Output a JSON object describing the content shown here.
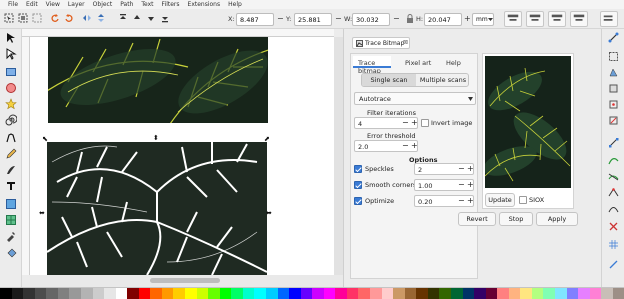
{
  "menubar": {
    "items": [
      "File",
      "Edit",
      "View",
      "Layer",
      "Object",
      "Path",
      "Text",
      "Filters",
      "Extensions",
      "Help"
    ]
  },
  "toolbar": {
    "x_label": "X:",
    "x_value": "8.487",
    "y_label": "Y:",
    "y_value": "25.881",
    "w_label": "W:",
    "w_value": "30.032",
    "h_label": "H:",
    "h_value": "20.047",
    "unit": "mm",
    "minus": "−",
    "plus": "+"
  },
  "dock": {
    "panel_tab": "Trace Bitmap",
    "close": "⊠",
    "tabs": [
      "Trace bitmap",
      "Pixel art",
      "Help"
    ],
    "scan_modes": [
      "Single scan",
      "Multiple scans"
    ],
    "algorithm": "Autotrace",
    "filter_iterations_label": "Filter iterations",
    "filter_iterations_value": "4",
    "invert_label": "Invert image",
    "error_threshold_label": "Error threshold",
    "error_threshold_value": "2.0",
    "options_heading": "Options",
    "options": [
      {
        "label": "Speckles",
        "value": "2"
      },
      {
        "label": "Smooth corners",
        "value": "1.00"
      },
      {
        "label": "Optimize",
        "value": "0.20"
      }
    ],
    "update_button": "Update",
    "sioх_label": "SIOX",
    "revert_button": "Revert",
    "stop_button": "Stop",
    "apply_button": "Apply",
    "minus": "−",
    "plus": "+"
  },
  "colors": {
    "accent": "#3a7bd5",
    "leaf_dark": "#1c2a1e",
    "leaf_yellow": "#c8d23a"
  },
  "palette": [
    "#000000",
    "#1a1a1a",
    "#333333",
    "#4d4d4d",
    "#666666",
    "#808080",
    "#999999",
    "#b3b3b3",
    "#cccccc",
    "#e6e6e6",
    "#ffffff",
    "#800000",
    "#ff0000",
    "#ff6600",
    "#ff9900",
    "#ffcc00",
    "#ffff00",
    "#ccff00",
    "#66ff00",
    "#00ff00",
    "#00ff66",
    "#00ffcc",
    "#00ffff",
    "#00ccff",
    "#0066ff",
    "#0000ff",
    "#6600ff",
    "#cc00ff",
    "#ff00ff",
    "#ff0099",
    "#ff3366",
    "#ff6666",
    "#ff9999",
    "#ffcccc",
    "#cc9966",
    "#996633",
    "#663300",
    "#333300",
    "#336600",
    "#006633",
    "#003366",
    "#330066",
    "#660033",
    "#ff8080",
    "#ffb380",
    "#ffe680",
    "#b3ff80",
    "#80ffb3",
    "#80e6ff",
    "#8080ff",
    "#e680ff",
    "#ff80d5",
    "#c8beb7",
    "#9d8f86"
  ]
}
